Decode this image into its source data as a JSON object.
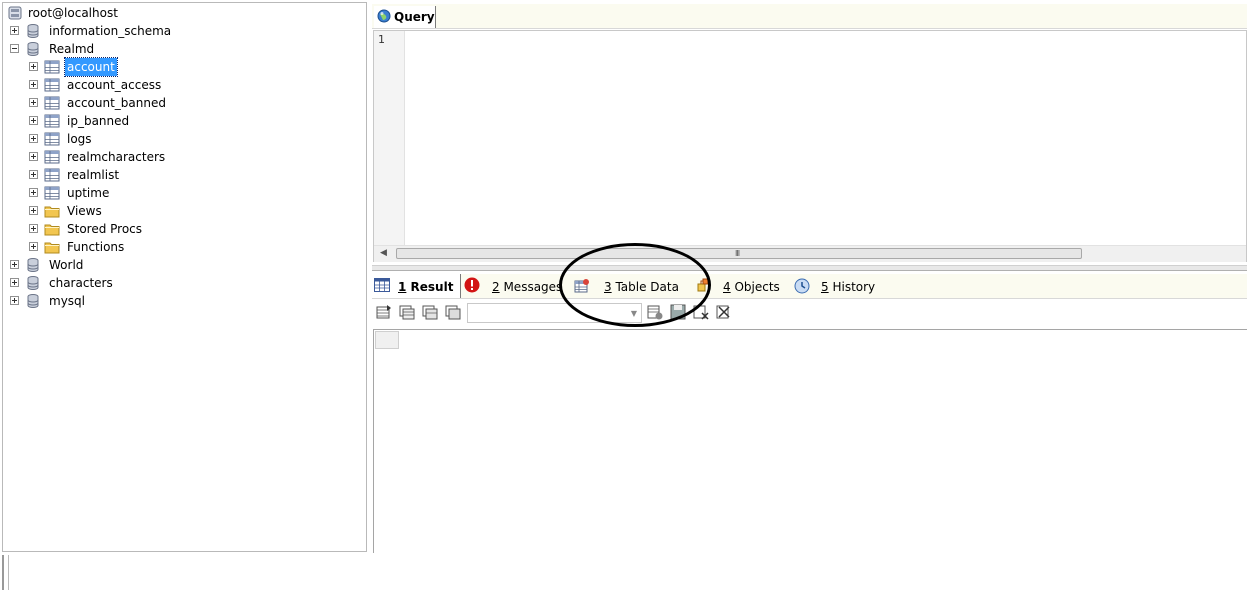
{
  "tree": {
    "root": "root@localhost",
    "databases": [
      {
        "name": "information_schema",
        "expanded": false
      },
      {
        "name": "Realmd",
        "expanded": true
      },
      {
        "name": "World",
        "expanded": false
      },
      {
        "name": "characters",
        "expanded": false
      },
      {
        "name": "mysql",
        "expanded": false
      }
    ],
    "realmd_tables": [
      "account",
      "account_access",
      "account_banned",
      "ip_banned",
      "logs",
      "realmcharacters",
      "realmlist",
      "uptime"
    ],
    "realmd_folders": [
      "Views",
      "Stored Procs",
      "Functions"
    ],
    "selected": "account"
  },
  "query_tab": {
    "label": "Query"
  },
  "editor": {
    "line_numbers": [
      "1"
    ],
    "scrollbar_grip": "III"
  },
  "result_tabs": [
    {
      "num": "1",
      "text": " Result",
      "icon": "grid-icon"
    },
    {
      "num": "2",
      "text": " Messages",
      "icon": "error-icon"
    },
    {
      "num": "3",
      "text": " Table Data",
      "icon": "table-data-icon"
    },
    {
      "num": "4",
      "text": " Objects",
      "icon": "objects-icon"
    },
    {
      "num": "5",
      "text": " History",
      "icon": "history-icon"
    }
  ],
  "result_toolbar": {
    "combo_value": ""
  },
  "colors": {
    "selection": "#3399ff",
    "tabbar": "#fbfbf0",
    "db_icon": "#8a94a8",
    "folder": "#f2c650"
  }
}
